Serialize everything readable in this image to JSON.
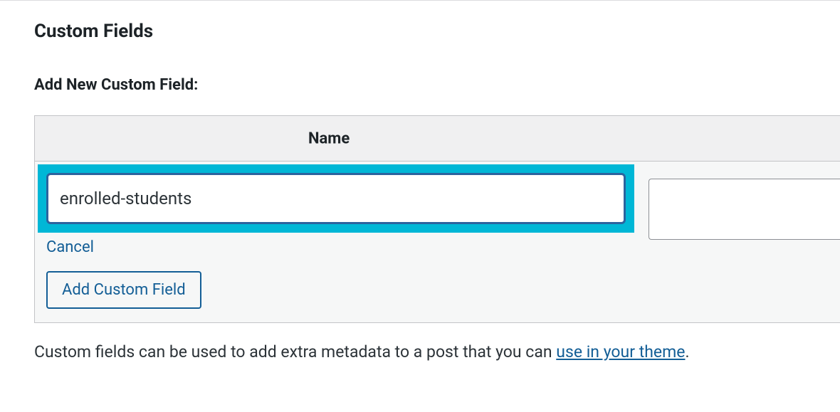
{
  "heading": "Custom Fields",
  "subheading": "Add New Custom Field:",
  "columns": {
    "name": "Name"
  },
  "form": {
    "name_value": "enrolled-students",
    "value_value": "",
    "cancel_label": "Cancel",
    "add_button_label": "Add Custom Field"
  },
  "footer": {
    "text_prefix": "Custom fields can be used to add extra metadata to a post that you can ",
    "link_text": "use in your theme",
    "text_suffix": "."
  }
}
